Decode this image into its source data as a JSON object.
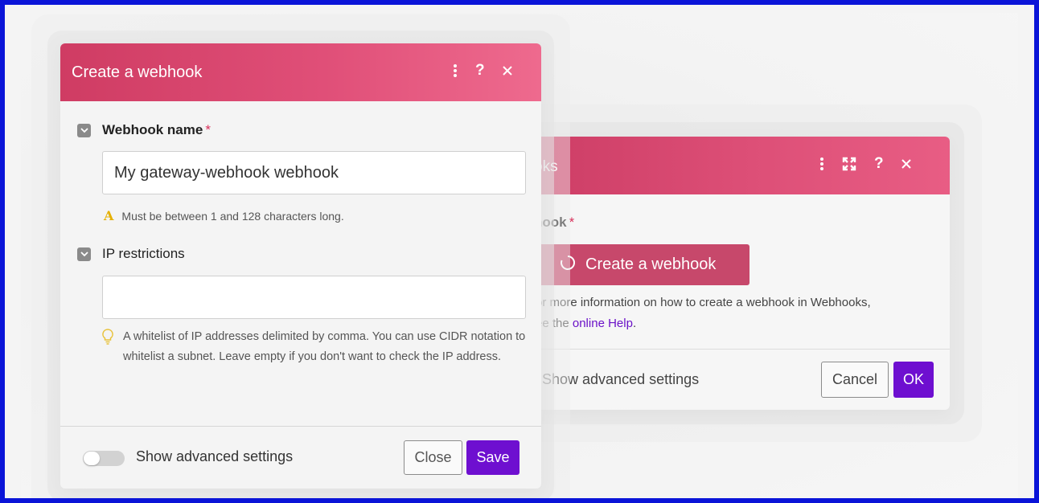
{
  "back_dialog": {
    "title": "oks",
    "field_label": "hook",
    "required_mark": "*",
    "create_button_label": "Create a webhook",
    "help_text_before": "or more information on how to create a webhook in Webhooks,",
    "help_text_line2_prefix": "ee the ",
    "help_link": "online Help",
    "help_text_suffix": ".",
    "advanced_label": "Show advanced settings",
    "cancel_label": "Cancel",
    "ok_label": "OK"
  },
  "front_dialog": {
    "title": "Create a webhook",
    "webhook_name_label": "Webhook name",
    "required_mark": "*",
    "webhook_name_value": "My gateway-webhook webhook",
    "webhook_name_hint": "Must be between 1 and 128 characters long.",
    "ip_label": "IP restrictions",
    "ip_value": "",
    "ip_hint": "A whitelist of IP addresses delimited by comma. You can use CIDR notation to whitelist a subnet. Leave empty if you don't want to check the IP address.",
    "advanced_label": "Show advanced settings",
    "advanced_enabled": false,
    "close_label": "Close",
    "save_label": "Save"
  },
  "colors": {
    "header_pink": "#dd4f77",
    "primary_purple": "#6e0fd0",
    "frame_blue": "#0a14d8",
    "required_red": "#d8315b"
  }
}
